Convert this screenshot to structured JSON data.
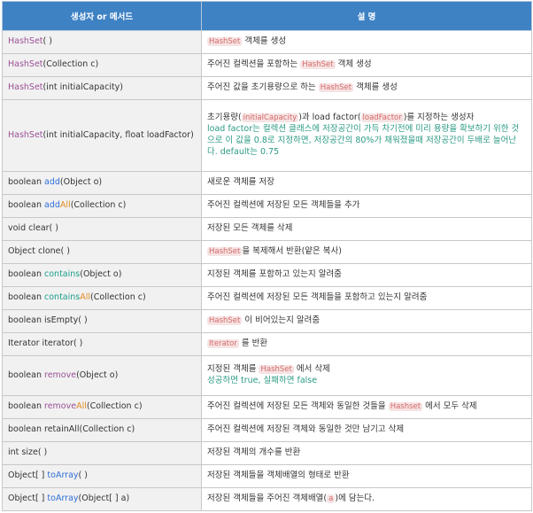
{
  "header": {
    "col1": "생성자 or 메서드",
    "col2": "설 명"
  },
  "rows": {
    "r0": {
      "m": "HashSet",
      "s": "( )",
      "d1": "HashSet",
      "d2": " 객체를 생성"
    },
    "r1": {
      "m": "HashSet",
      "s": "(Collection c)",
      "d1": "주어진 컬렉션을 포함하는 ",
      "d2": "HashSet",
      "d3": " 객체 생성"
    },
    "r2": {
      "m": "HashSet",
      "s": "(int initialCapacity)",
      "d1": "주어진 값을 초기용량으로 하는 ",
      "d2": "HashSet",
      "d3": " 객체를 생성"
    },
    "r3": {
      "m": "HashSet",
      "s": "(int initialCapacity, float loadFactor)",
      "d1": "초기용량(",
      "d2": "initialCapacity",
      "d3": ")과 load factor(",
      "d4": "loadFactor",
      "d5": ")를 지정하는 생성자",
      "d6": "load factor는 컬렉션 클래스에 저장공간이 가득 차기전에 미리 용량을 확보하기 위한 것으로 이 값을 0.8로 지정하면, 저장공간의 80%가 채워졌을때 저장공간이 두배로 늘어난다. default는 0.75"
    },
    "r4": {
      "p": "boolean ",
      "m": "add",
      "s": "(Object o)",
      "d1": "새로운 객체를 저장"
    },
    "r5": {
      "p": "boolean ",
      "m1": "add",
      "m2": "All",
      "s": "(Collection c)",
      "d1": "주어진 컬렉션에 저장된 모든 객체들을 추가"
    },
    "r6": {
      "t": "void clear( )",
      "d1": "저장된 모든 객체를 삭제"
    },
    "r7": {
      "t": "Object clone( )",
      "d1": "HashSet",
      "d2": "을 복제해서 반환(얕은 복사)"
    },
    "r8": {
      "p": "boolean ",
      "m": "contains",
      "s": "(Object o)",
      "d1": "지정된 객체를 포함하고 있는지 알려줌"
    },
    "r9": {
      "p": "boolean ",
      "m1": "contains",
      "m2": "All",
      "s": "(Collection c)",
      "d1": "주어진 컬렉션에 저장된 모든 객체들을 포함하고 있는지 알려줌"
    },
    "r10": {
      "t": "boolean isEmpty( )",
      "d1": "HashSet",
      "d2": " 이 비어있는지 알려줌"
    },
    "r11": {
      "t": "Iterator iterator( )",
      "d1": "Iterator",
      "d2": " 를 반환"
    },
    "r12": {
      "p": "boolean ",
      "m": "remove",
      "s": "(Object o)",
      "d1": "지정된 객체를 ",
      "d2": "HashSet",
      "d3": " 에서 삭제",
      "d4": "성공하면 true, 실패하면 false"
    },
    "r13": {
      "p": "boolean ",
      "m1": "remove",
      "m2": "All",
      "s": "(Collection c)",
      "d1": "주어진 컬렉션에 저장된 모든 객체와 동일한 것들을 ",
      "d2": "Hashset",
      "d3": " 에서 모두 삭제"
    },
    "r14": {
      "t": "boolean retainAll(Collection c)",
      "d1": "주어진 컬렉션에 저장된 객체와 동일한 것만 남기고 삭제"
    },
    "r15": {
      "t": "int size( )",
      "d1": "저장된 객체의 개수를 반환"
    },
    "r16": {
      "p": "Object[ ] ",
      "m": "toArray",
      "s": "( )",
      "d1": "저장된 객체들을 객체배열의 형태로 반환"
    },
    "r17": {
      "p": "Object[ ] ",
      "m": "toArray",
      "s": "(Object[ ] a)",
      "d1": "저장된 객체들을 주어진 객체배열(",
      "d2": "a",
      "d3": ")에 담는다."
    }
  }
}
